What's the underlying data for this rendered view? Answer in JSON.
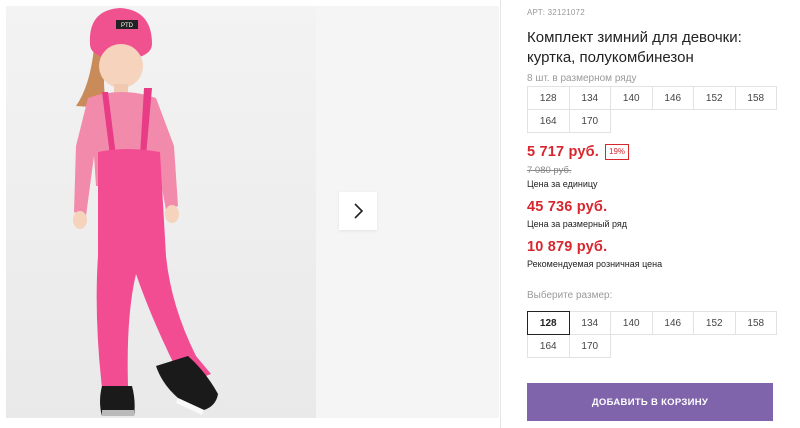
{
  "product": {
    "article": "АРТ: 32121072",
    "title": "Комплект зимний для девочки: куртка, полукомбинезон",
    "pack_label": "8 шт. в размерном ряду",
    "pack_sizes": [
      "128",
      "134",
      "140",
      "146",
      "152",
      "158",
      "164",
      "170"
    ]
  },
  "pricing": {
    "unit_price": "5 717 руб.",
    "discount_badge": "19%",
    "old_price": "7 080 руб.",
    "unit_caption": "Цена за единицу",
    "row_price": "45 736 руб.",
    "row_caption": "Цена за размерный ряд",
    "retail_price": "10 879 руб.",
    "retail_caption": "Рекомендуемая розничная цена"
  },
  "size_picker": {
    "label": "Выберите размер:",
    "selected": "128",
    "options": [
      "128",
      "134",
      "140",
      "146",
      "152",
      "158",
      "164",
      "170"
    ]
  },
  "actions": {
    "add_to_cart": "ДОБАВИТЬ В КОРЗИНУ"
  },
  "gallery": {
    "next_icon": "chevron-right-icon",
    "hat_text": "PTD"
  },
  "colors": {
    "price_red": "#d7262e",
    "button_purple": "#7f63ab",
    "pants_pink": "#f24c92"
  }
}
